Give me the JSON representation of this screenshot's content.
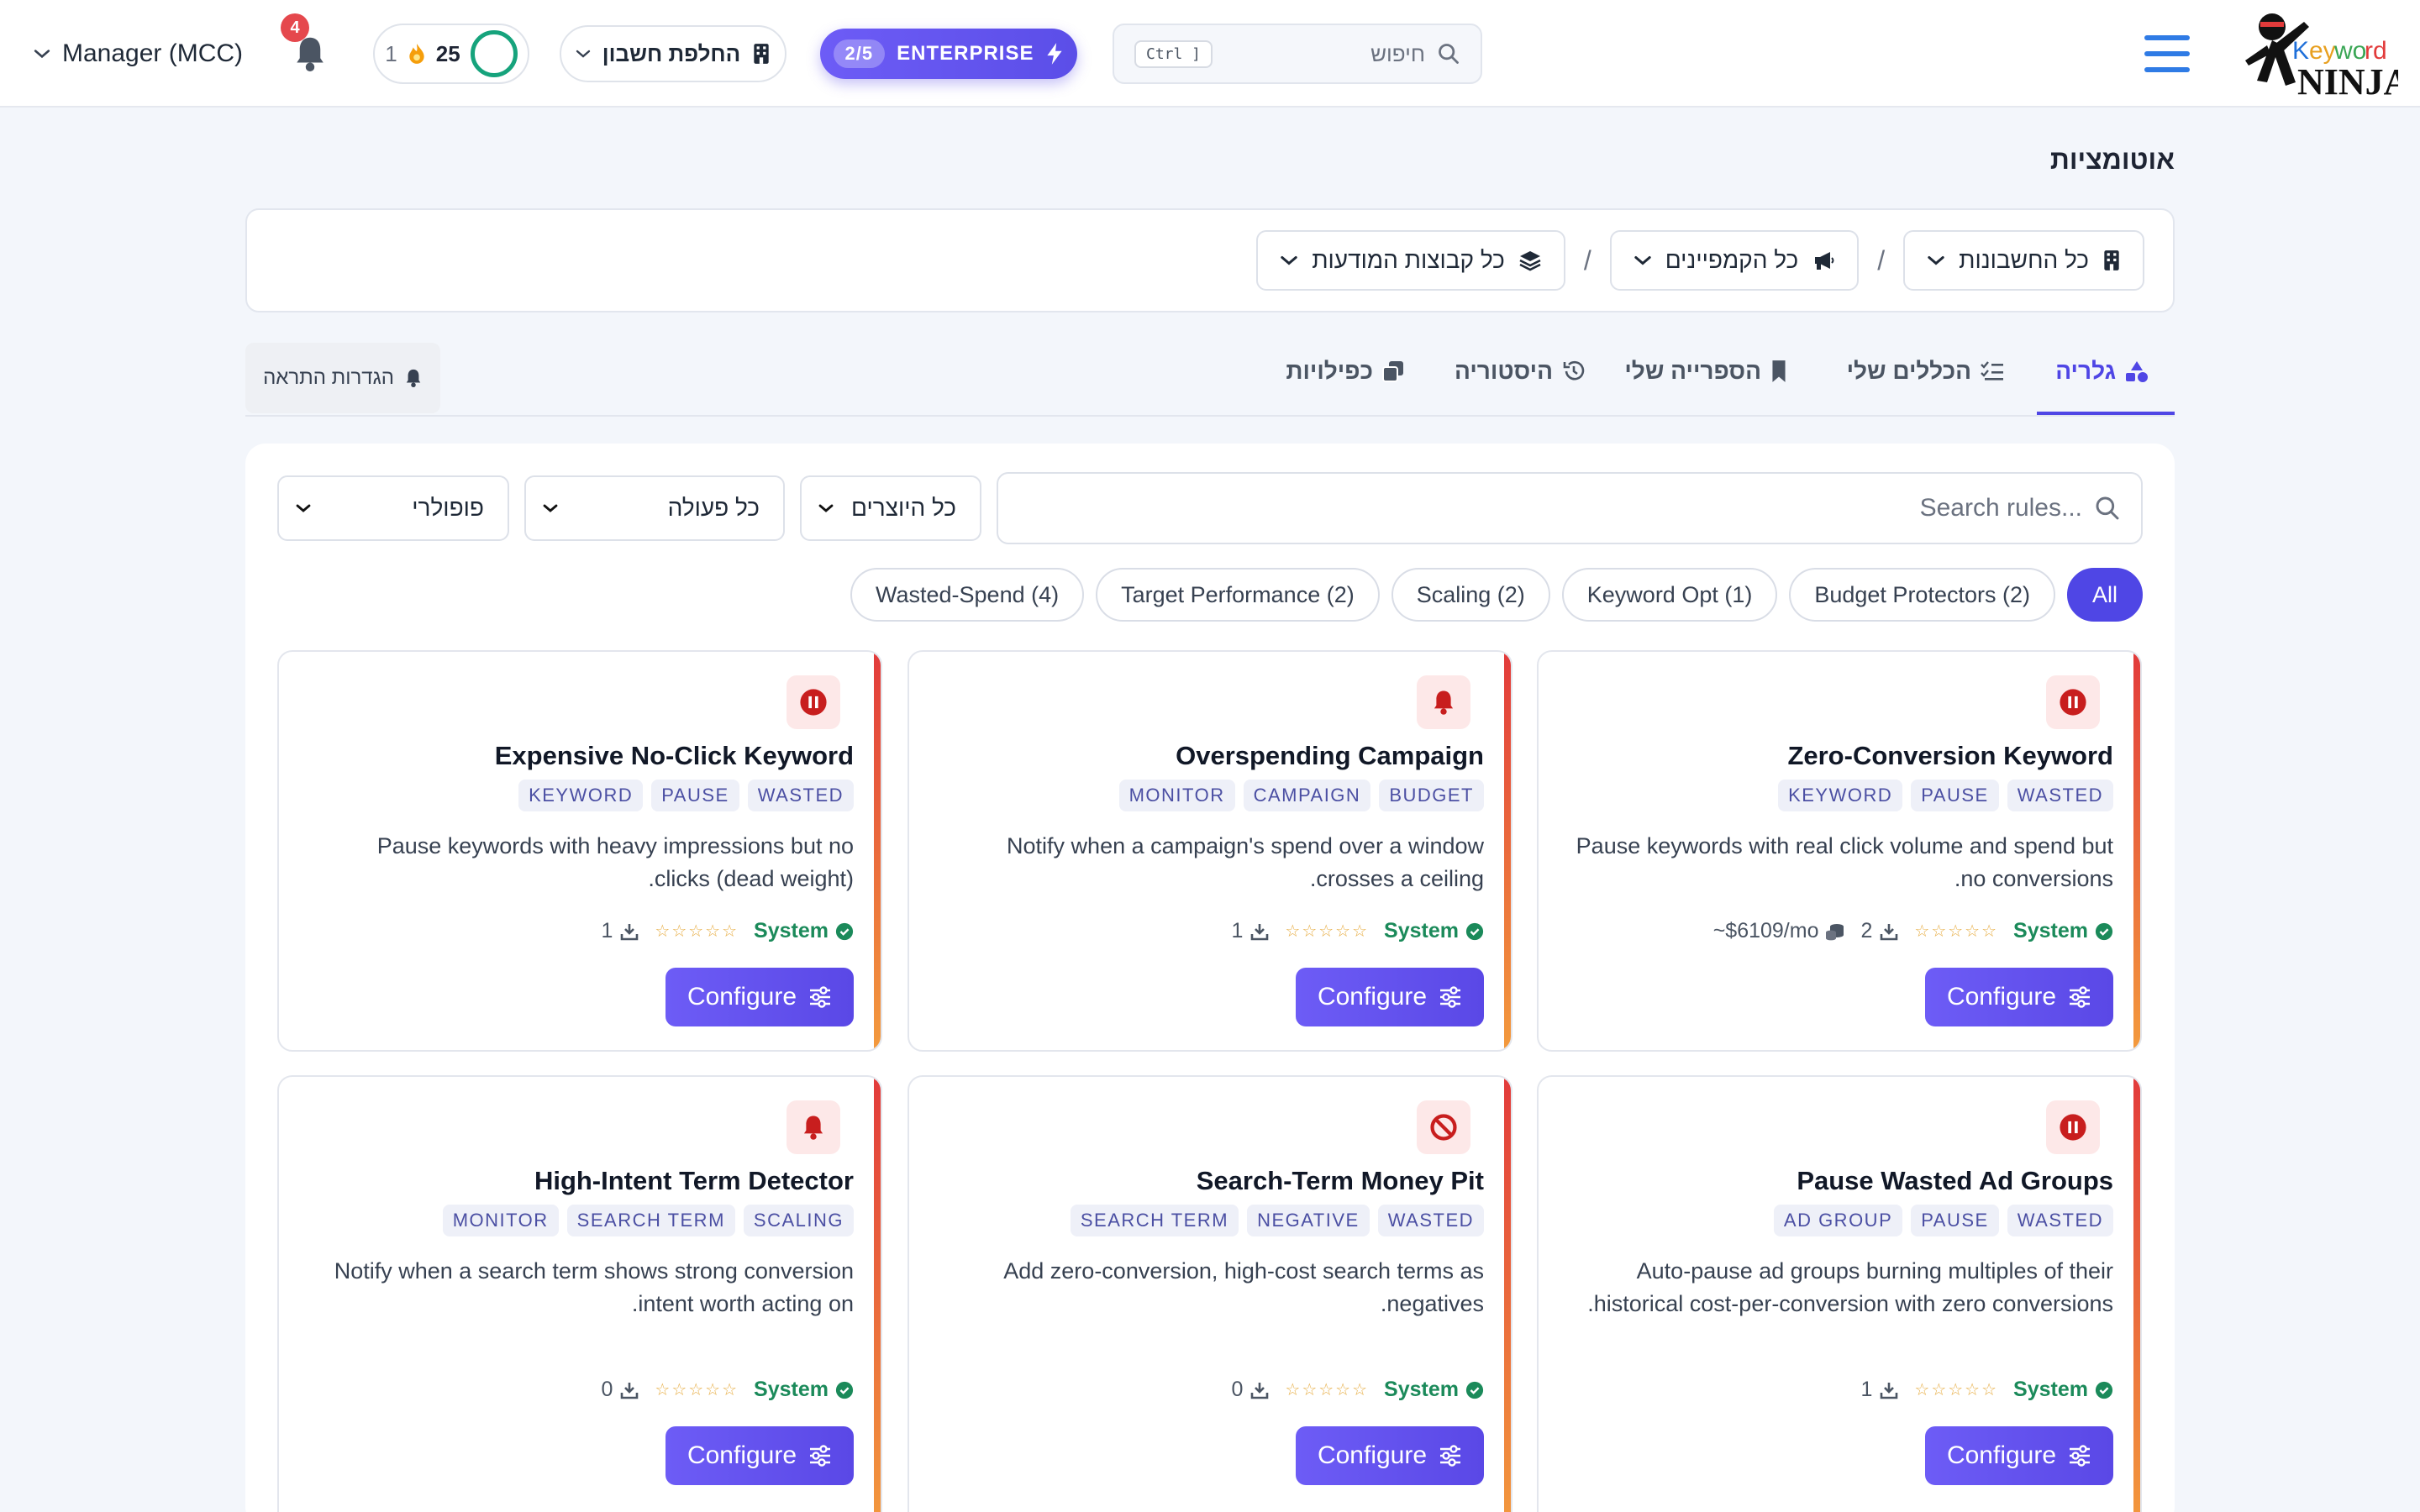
{
  "header": {
    "search_placeholder": "חיפוש",
    "search_kbd": "Ctrl ]",
    "plan_usage": "2/5",
    "plan_name": "ENTERPRISE",
    "switch_account": "החלפת חשבון",
    "score_value": "25",
    "streak_value": "1",
    "notifications_count": "4",
    "account_name": "Manager (MCC)"
  },
  "page": {
    "title": "אוטומציות"
  },
  "filters": {
    "accounts": "כל החשבונות",
    "campaigns": "כל הקמפיינים",
    "ad_groups": "כל קבוצות המודעות",
    "separator": "/"
  },
  "tabs": {
    "gallery": "גלריה",
    "my_rules": "הכללים שלי",
    "my_library": "הספרייה שלי",
    "history": "היסטוריה",
    "duplicates": "כפילויות",
    "alert_settings": "הגדרות התראה"
  },
  "gallery": {
    "search_placeholder": "Search rules...",
    "creators_select": "כל היוצרים",
    "action_select": "כל פעולה",
    "sort_select": "פופולרי",
    "chips": [
      "All",
      "Budget Protectors (2)",
      "Keyword Opt (1)",
      "Scaling (2)",
      "Target Performance (2)",
      "Wasted-Spend (4)"
    ],
    "system_label": "System",
    "stars": "☆☆☆☆☆",
    "configure_label": "Configure",
    "cards": [
      {
        "title": "Zero-Conversion Keyword",
        "tags": [
          "WASTED",
          "PAUSE",
          "KEYWORD"
        ],
        "description": "Pause keywords with real click volume and spend but no conversions.",
        "downloads": "2",
        "cost": "~$6109/mo",
        "icon": "pause-icon"
      },
      {
        "title": "Overspending Campaign",
        "tags": [
          "BUDGET",
          "CAMPAIGN",
          "MONITOR"
        ],
        "description": "Notify when a campaign's spend over a window crosses a ceiling.",
        "downloads": "1",
        "icon": "bell-icon"
      },
      {
        "title": "Expensive No-Click Keyword",
        "tags": [
          "WASTED",
          "PAUSE",
          "KEYWORD"
        ],
        "description": "Pause keywords with heavy impressions but no clicks (dead weight).",
        "downloads": "1",
        "icon": "pause-icon"
      },
      {
        "title": "Pause Wasted Ad Groups",
        "tags": [
          "WASTED",
          "PAUSE",
          "AD GROUP"
        ],
        "description": "Auto-pause ad groups burning multiples of their historical cost-per-conversion with zero conversions.",
        "downloads": "1",
        "icon": "pause-icon"
      },
      {
        "title": "Search-Term Money Pit",
        "tags": [
          "WASTED",
          "NEGATIVE",
          "SEARCH TERM"
        ],
        "description": "Add zero-conversion, high-cost search terms as negatives.",
        "downloads": "0",
        "icon": "ban-icon"
      },
      {
        "title": "High-Intent Term Detector",
        "tags": [
          "SCALING",
          "SEARCH TERM",
          "MONITOR"
        ],
        "description": "Notify when a search term shows strong conversion intent worth acting on.",
        "downloads": "0",
        "icon": "bell-icon"
      }
    ]
  },
  "colors": {
    "accent": "#4f46e5",
    "success": "#1b8a5a",
    "danger": "#c81e1e",
    "brand_red": "#e23b3b"
  }
}
